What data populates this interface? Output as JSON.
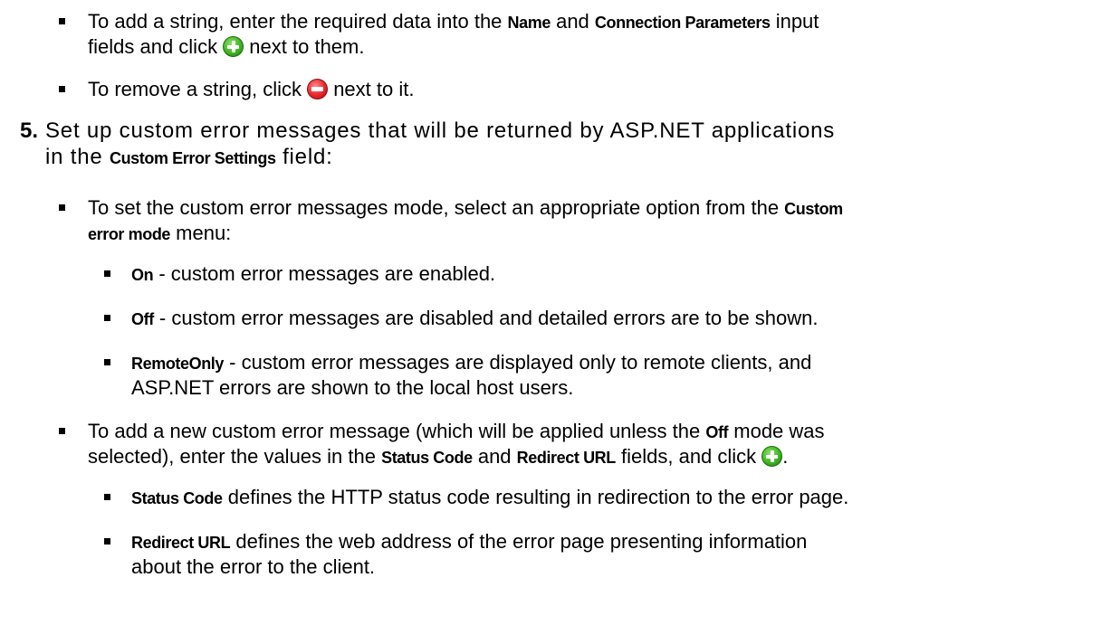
{
  "bullets_top": {
    "add_string": {
      "p1": "To add a string, enter the required data into the ",
      "b1": "Name",
      "p2": " and ",
      "b2": "Connection Parameters",
      "p3": " input",
      "p4": "fields and click ",
      "p5": " next to them."
    },
    "remove_string": {
      "p1": "To remove a string, click ",
      "p2": " next to it."
    }
  },
  "step5": {
    "number": "5.",
    "line1": "Set up custom error messages that will be returned by ASP.NET applications",
    "line2_a": "in the ",
    "line2_b": "Custom Error Settings",
    "line2_c": " field:"
  },
  "mode_bullet": {
    "p1": "To set the custom error messages mode, select an appropriate option from the ",
    "b1": "Custom",
    "b2": "error mode",
    "p2": " menu:"
  },
  "modes": [
    {
      "name": "On",
      "desc": " - custom error messages are enabled."
    },
    {
      "name": "Off",
      "desc": " - custom error messages are disabled and detailed errors are to be shown."
    },
    {
      "name": "RemoteOnly",
      "desc": " - custom error messages are displayed only to remote clients, and",
      "desc2": "ASP.NET errors are shown to the local host users."
    }
  ],
  "add_message_bullet": {
    "p1": "To add a new custom error message (which will be applied unless the ",
    "b1": "Off",
    "p2": " mode was",
    "p3": "selected), enter the values in the ",
    "b2": "Status Code",
    "p4": " and ",
    "b3": "Redirect URL",
    "p5": " fields, and click ",
    "p6": "."
  },
  "fields": [
    {
      "name": "Status Code",
      "desc": " defines the HTTP status code resulting in redirection to the error page."
    },
    {
      "name": "Redirect URL",
      "desc": " defines the web address of the error page presenting information",
      "desc2": "about the error to the client."
    }
  ],
  "icons": {
    "add": "add-circle-icon",
    "remove": "remove-circle-icon"
  }
}
